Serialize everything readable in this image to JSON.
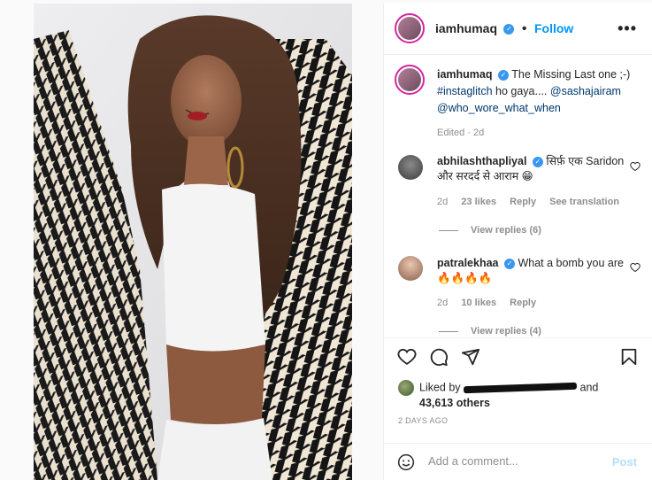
{
  "post": {
    "username": "iamhumaq",
    "follow_label": "Follow",
    "more_label": "•••",
    "separator": "•"
  },
  "caption": {
    "username": "iamhumaq",
    "text": "The Missing Last one ;-)",
    "hashtag": "#instaglitch",
    "text2": "ho gaya....",
    "mention1": "@sashajairam",
    "mention2": "@who_wore_what_when",
    "meta": "Edited · 2d"
  },
  "comments": [
    {
      "username": "abhilashthapliyal",
      "text": "सिर्फ़ एक Saridon और सरदर्द से आराम 😁",
      "age": "2d",
      "likes": "23 likes",
      "reply": "Reply",
      "translate": "See translation",
      "view_replies": "View replies (6)"
    },
    {
      "username": "patralekhaa",
      "text": "What a bomb you are🔥🔥🔥🔥",
      "age": "2d",
      "likes": "10 likes",
      "reply": "Reply",
      "view_replies": "View replies (4)"
    }
  ],
  "likes": {
    "liked_by": "Liked by",
    "and": "and",
    "others": "43,613 others"
  },
  "timestamp": "2 DAYS AGO",
  "composer": {
    "placeholder": "Add a comment...",
    "post_label": "Post"
  },
  "colors": {
    "accent": "#0095f6",
    "verified": "#3897f0",
    "link": "#00376b",
    "muted": "#8e8e8e"
  }
}
